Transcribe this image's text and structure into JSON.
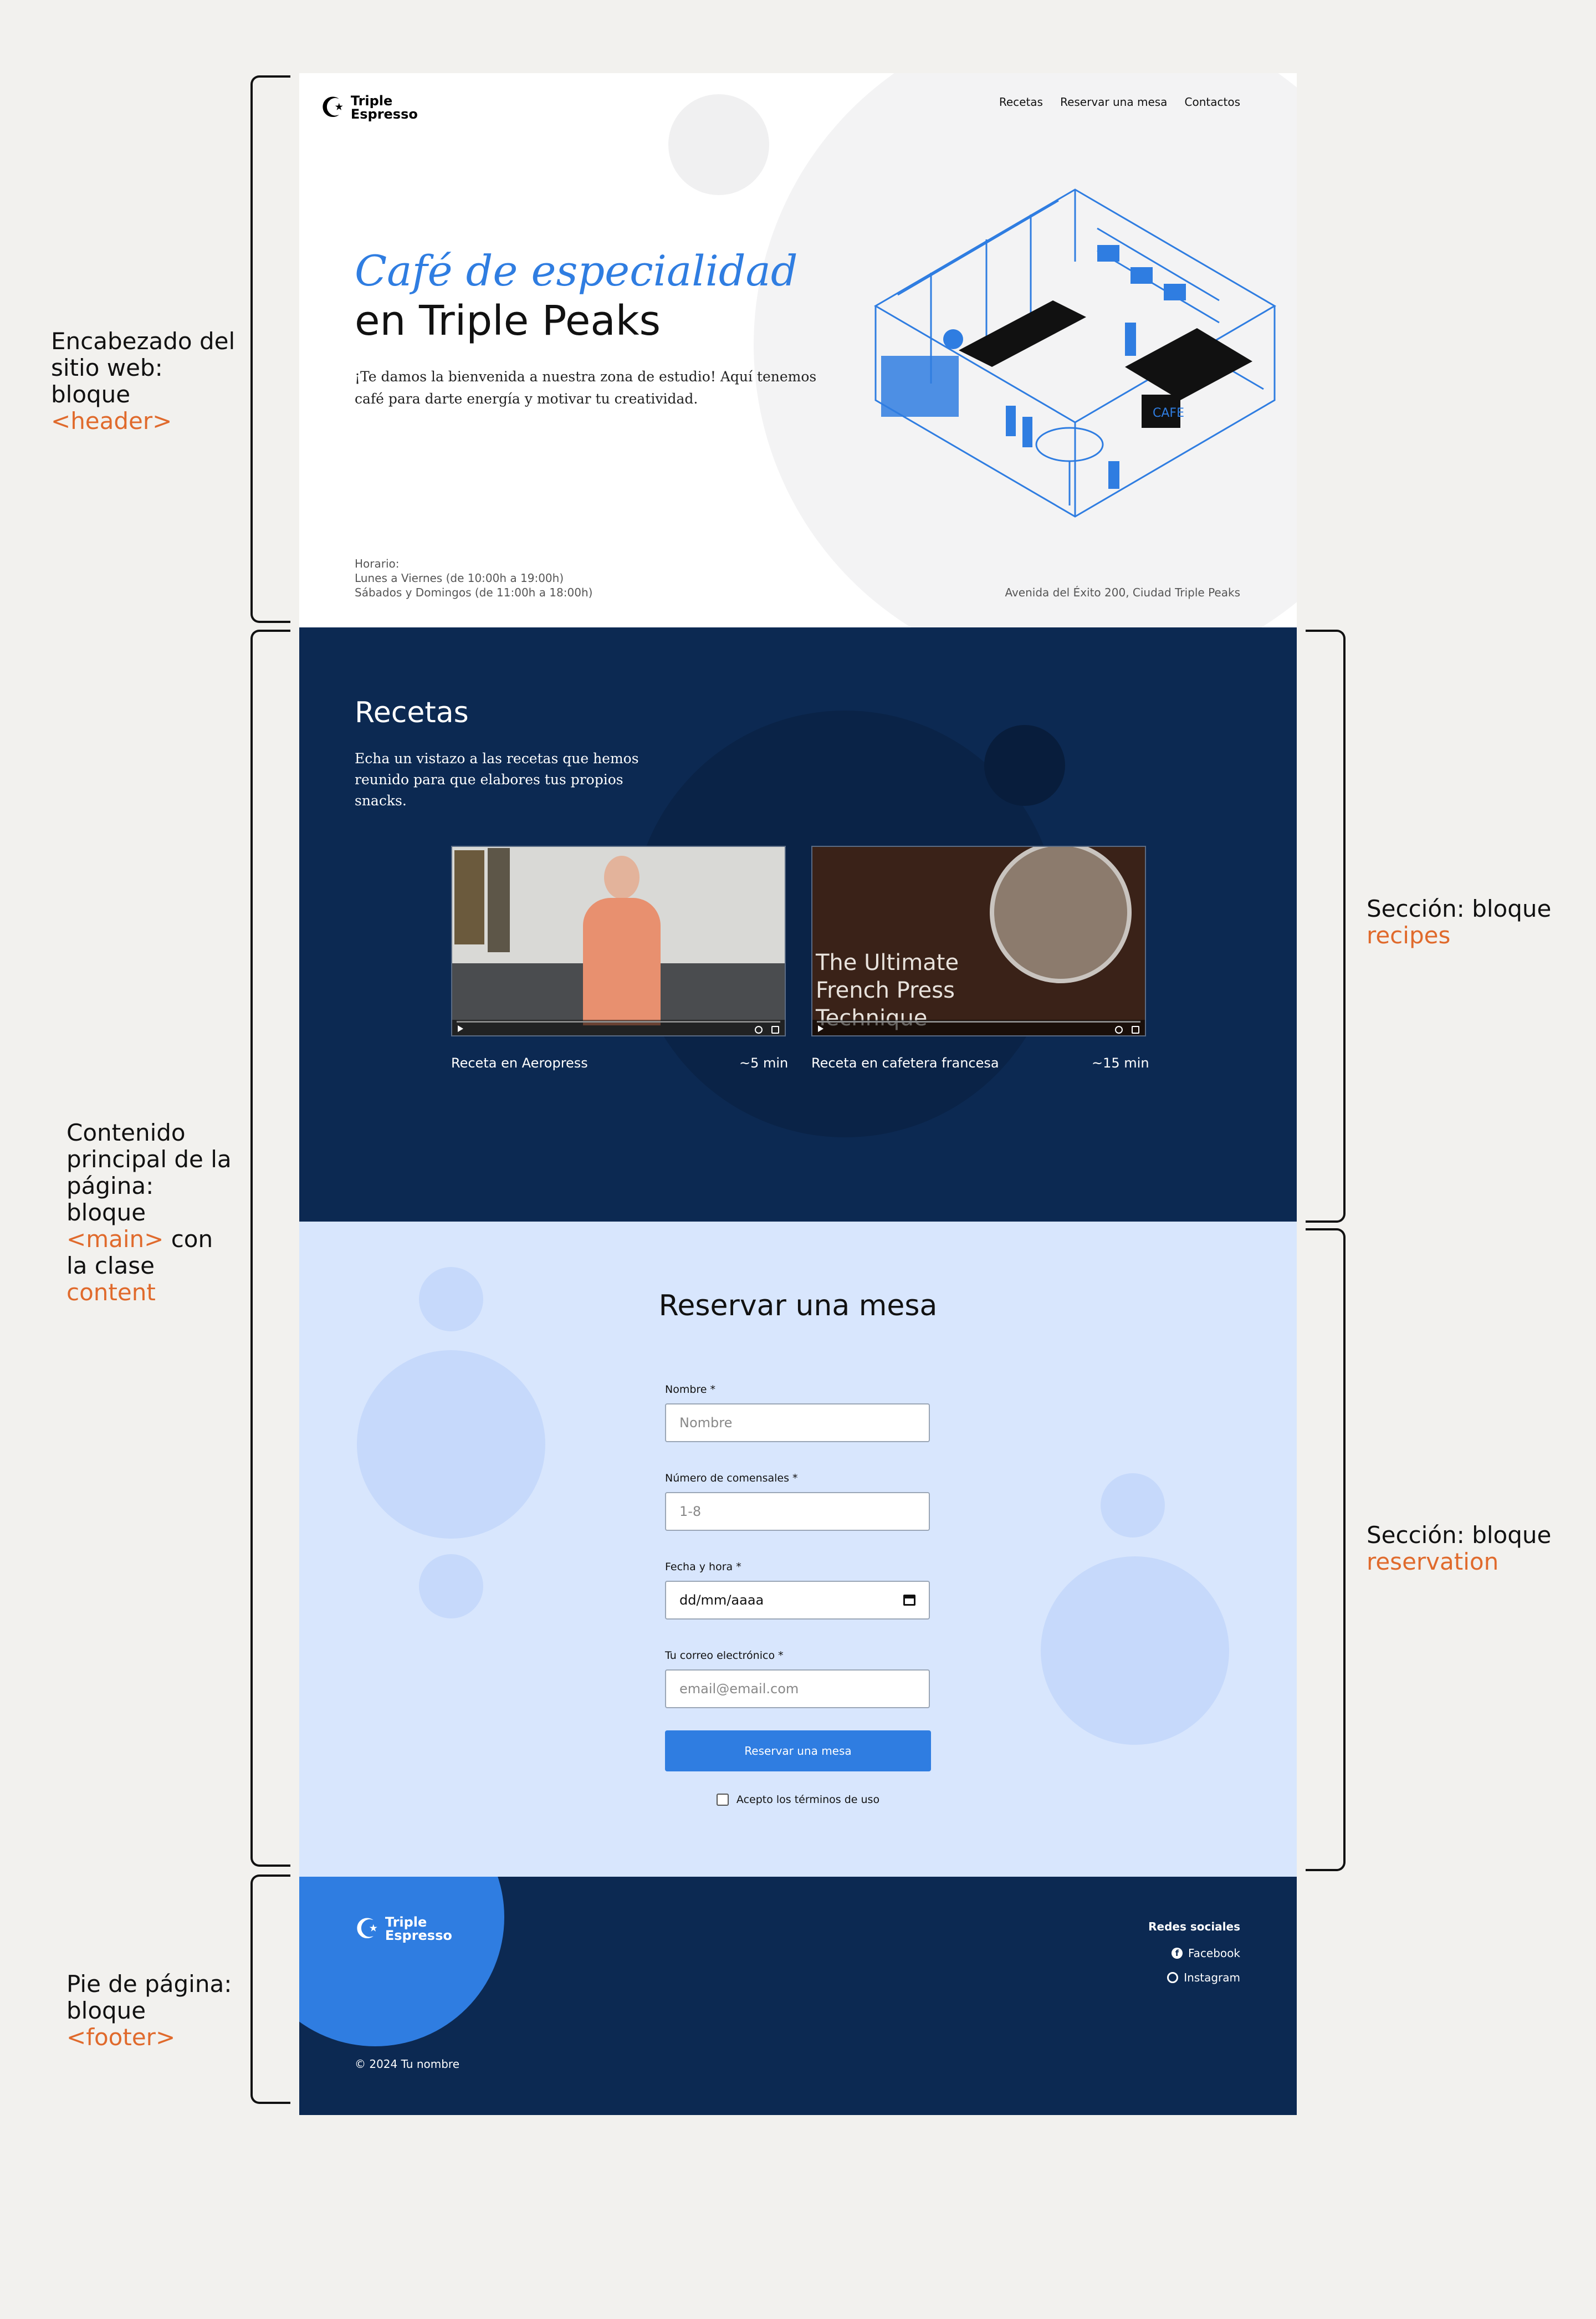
{
  "annotations": {
    "header": {
      "text": "Encabezado del sitio web: bloque",
      "tag": "<header>"
    },
    "main": {
      "text": "Contenido principal de la página: bloque",
      "tag": "<main>",
      "middle": "con la clase",
      "cls": "content"
    },
    "footer": {
      "text": "Pie de página: bloque",
      "tag": "<footer>"
    },
    "recipes": {
      "text": "Sección: bloque",
      "tag": "recipes"
    },
    "reservation": {
      "text": "Sección: bloque",
      "tag": "reservation"
    }
  },
  "header": {
    "logo_line1": "Triple",
    "logo_line2": "Espresso",
    "nav": [
      "Recetas",
      "Reservar una mesa",
      "Contactos"
    ],
    "title_line1": "Café de especialidad",
    "title_line2": "en Triple Peaks",
    "intro": "¡Te damos la bienvenida a nuestra zona de estudio! Aquí tenemos café para darte energía y motivar tu creatividad.",
    "hours_label": "Horario:",
    "hours_weekdays": "Lunes a Viernes (de 10:00h a 19:00h)",
    "hours_weekend": "Sábados y Domingos (de 11:00h a 18:00h)",
    "address": "Avenida del Éxito 200, Ciudad Triple Peaks",
    "illustration_text": "CAFE"
  },
  "recipes": {
    "title": "Recetas",
    "intro": "Echa un vistazo a las recetas que hemos reunido para que elabores tus propios snacks.",
    "items": [
      {
        "name": "Receta en Aeropress",
        "time": "~5 min"
      },
      {
        "name": "Receta en cafetera francesa",
        "time": "~15 min",
        "overlay": "The Ultimate French Press Technique"
      }
    ]
  },
  "reservation": {
    "title": "Reservar una mesa",
    "fields": [
      {
        "label": "Nombre *",
        "placeholder": "Nombre"
      },
      {
        "label": "Número de comensales *",
        "placeholder": "1-8"
      },
      {
        "label": "Fecha y hora *",
        "value": "dd/mm/aaaa"
      },
      {
        "label": "Tu correo electrónico *",
        "placeholder": "email@email.com"
      }
    ],
    "submit": "Reservar una mesa",
    "terms": "Acepto los términos de uso"
  },
  "footer": {
    "logo_line1": "Triple",
    "logo_line2": "Espresso",
    "social_title": "Redes sociales",
    "social": [
      "Facebook",
      "Instagram"
    ],
    "copyright": "© 2024 Tu nombre"
  },
  "colors": {
    "accent": "#2f7de1",
    "navy": "#0c2952",
    "light_blue": "#d8e6fd",
    "annotation": "#e06a2c"
  }
}
